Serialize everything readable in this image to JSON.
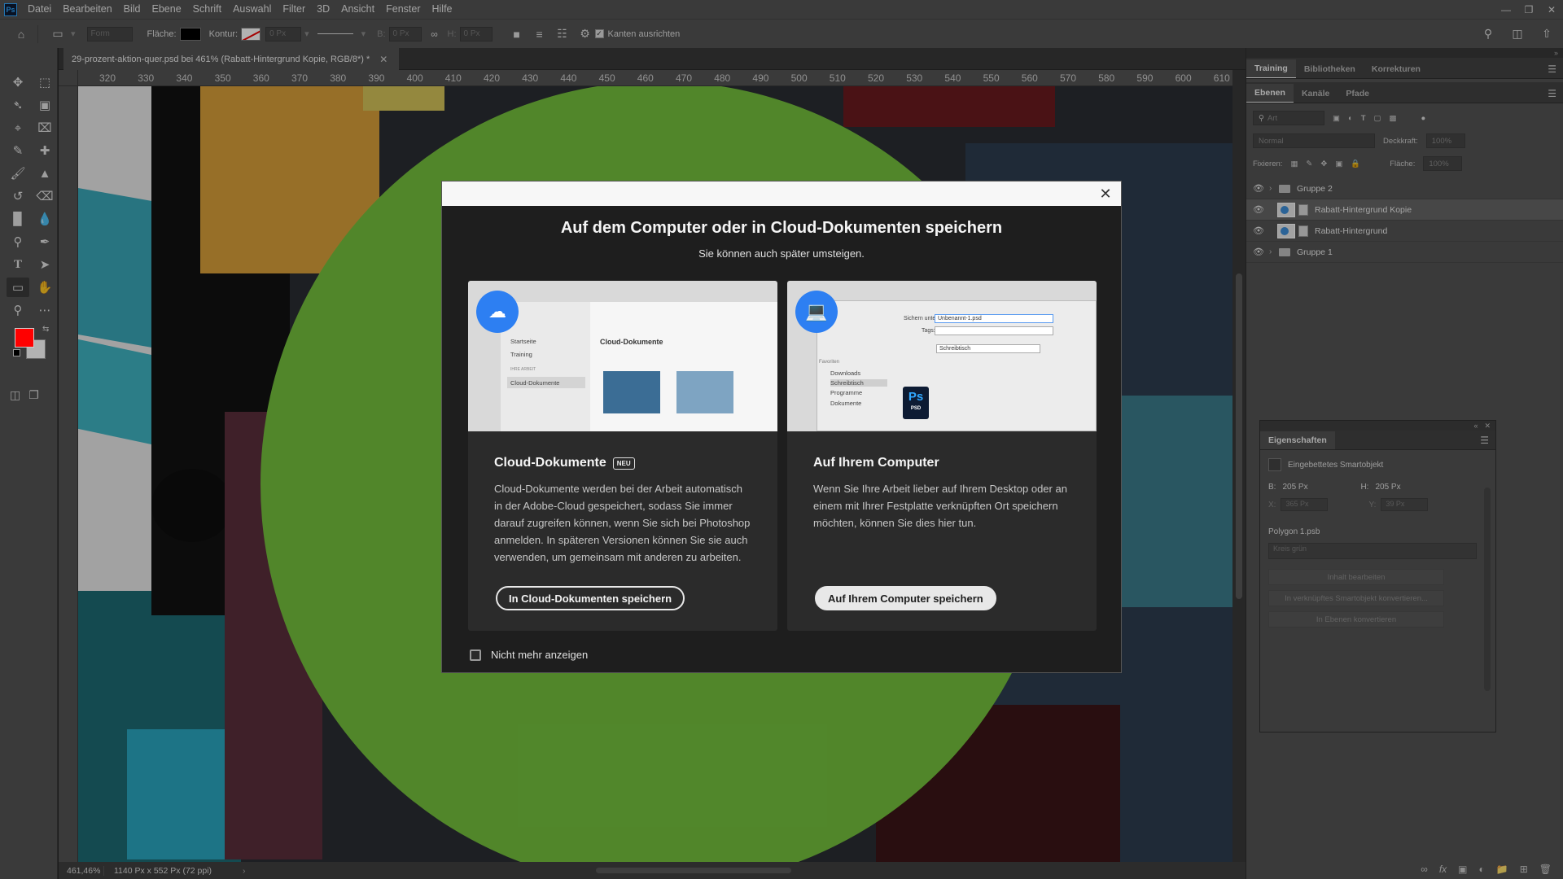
{
  "app": {
    "logo": "Ps",
    "menu": [
      "Datei",
      "Bearbeiten",
      "Bild",
      "Ebene",
      "Schrift",
      "Auswahl",
      "Filter",
      "3D",
      "Ansicht",
      "Fenster",
      "Hilfe"
    ]
  },
  "options": {
    "shape_mode": "Form",
    "fill_label": "Fläche:",
    "stroke_label": "Kontur:",
    "stroke_width": "0 Px",
    "w_label": "B:",
    "w_value": "0 Px",
    "h_label": "H:",
    "h_value": "0 Px",
    "align_edges_label": "Kanten ausrichten"
  },
  "document": {
    "tab_title": "29-prozent-aktion-quer.psd bei 461% (Rabatt-Hintergrund Kopie, RGB/8*) *",
    "ruler_ticks": [
      "320",
      "330",
      "340",
      "350",
      "360",
      "370",
      "380",
      "390",
      "400",
      "410",
      "420",
      "430",
      "440",
      "450",
      "460",
      "470",
      "480",
      "490",
      "500",
      "510",
      "520",
      "530",
      "540",
      "550",
      "560",
      "570",
      "580",
      "590",
      "600",
      "610"
    ],
    "zoom": "461,46%",
    "doc_info": "1140 Px x 552 Px (72 ppi)"
  },
  "colors": {
    "accent": "#74c13d",
    "foreground": "#ff0000",
    "background": "#ffffff",
    "dialog_badge": "#2d7ff2"
  },
  "panels": {
    "top_tabs": [
      "Training",
      "Bibliotheken",
      "Korrekturen"
    ],
    "layer_tabs": [
      "Ebenen",
      "Kanäle",
      "Pfade"
    ],
    "filter_placeholder": "Art",
    "blend_mode": "Normal",
    "opacity_label": "Deckkraft:",
    "opacity_value": "100%",
    "lock_label": "Fixieren:",
    "fill_label": "Fläche:",
    "fill_value": "100%",
    "layers": [
      {
        "name": "Gruppe 2",
        "type": "group"
      },
      {
        "name": "Rabatt-Hintergrund Kopie",
        "type": "smart",
        "selected": true
      },
      {
        "name": "Rabatt-Hintergrund",
        "type": "smart"
      },
      {
        "name": "Gruppe 1",
        "type": "group"
      }
    ]
  },
  "properties": {
    "tab": "Eigenschaften",
    "object_type": "Eingebettetes Smartobjekt",
    "w_label": "B:",
    "w_value": "205 Px",
    "h_label": "H:",
    "h_value": "205 Px",
    "x_label": "X:",
    "x_value": "365 Px",
    "y_label": "Y:",
    "y_value": "39 Px",
    "file": "Polygon 1.psb",
    "layer_comp": "Kreis grün",
    "btn_edit": "Inhalt bearbeiten",
    "btn_convert_linked": "In verknüpftes Smartobjekt konvertieren...",
    "btn_convert_layers": "In Ebenen konvertieren"
  },
  "dialog": {
    "title": "Auf dem Computer oder in Cloud-Dokumenten speichern",
    "subtitle": "Sie können auch später umsteigen.",
    "cloud": {
      "title": "Cloud-Dokumente",
      "badge": "NEU",
      "body": "Cloud-Dokumente werden bei der Arbeit automatisch in der Adobe-Cloud gespeichert, sodass Sie immer darauf zugreifen können, wenn Sie sich bei Photoshop anmelden. In späteren Versionen können Sie sie auch verwenden, um gemeinsam mit anderen zu arbeiten.",
      "button": "In Cloud-Dokumenten speichern",
      "mock": {
        "nav": [
          "Startseite",
          "Training"
        ],
        "section": "IHRE ARBEIT",
        "active_item": "Cloud-Dokumente",
        "main_title": "Cloud-Dokumente"
      }
    },
    "local": {
      "title": "Auf Ihrem Computer",
      "body": "Wenn Sie Ihre Arbeit lieber auf Ihrem Desktop oder an einem mit Ihrer Festplatte verknüpften Ort speichern möchten, können Sie dies hier tun.",
      "button": "Auf Ihrem Computer speichern",
      "mock": {
        "save_as_label": "Sichern unter:",
        "save_as_value": "Unbenannt-1.psd",
        "tags_label": "Tags:",
        "location": "Schreibtisch",
        "favorites_label": "Favoriten",
        "favorites": [
          "Downloads",
          "Schreibtisch",
          "Programme",
          "Dokumente"
        ],
        "file_badge": "Ps",
        "file_ext": "PSD"
      }
    },
    "dont_show": "Nicht mehr anzeigen"
  }
}
